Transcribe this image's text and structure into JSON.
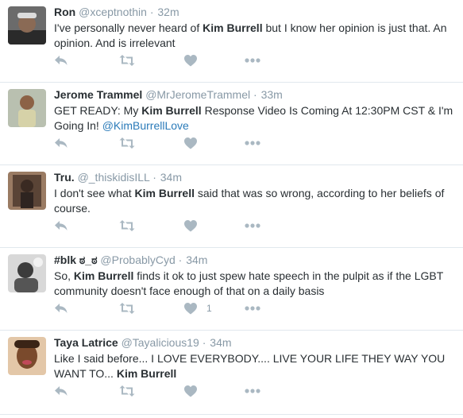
{
  "tweets": [
    {
      "name": "Ron",
      "handle": "@xceptnothin",
      "time": "32m",
      "text_parts": [
        "I've personally never heard of ",
        "Kim Burrell",
        " but I know her opinion is just that. An opinion. And is irrelevant"
      ],
      "likes": ""
    },
    {
      "name": "Jerome Trammel",
      "handle": "@MrJeromeTrammel",
      "time": "33m",
      "text_parts": [
        "GET READY: My ",
        "Kim Burrell",
        " Response Video Is Coming At 12:30PM CST & I'm Going In! ",
        "@KimBurrellLove"
      ],
      "likes": ""
    },
    {
      "name": "Tru.",
      "handle": "@_thiskidisILL",
      "time": "34m",
      "text_parts": [
        "I don't see what ",
        "Kim Burrell",
        " said that was so wrong, according to her beliefs of course."
      ],
      "likes": ""
    },
    {
      "name": "#blk ಠ_ಠ",
      "handle": "@ProbablyCyd",
      "time": "34m",
      "text_parts": [
        "So, ",
        "Kim Burrell",
        " finds it ok to just spew hate speech in the pulpit as if the LGBT community doesn't face enough of that on a daily basis"
      ],
      "likes": "1"
    },
    {
      "name": "Taya Latrice",
      "handle": "@Tayalicious19",
      "time": "34m",
      "text_parts": [
        "Like I said before... I LOVE EVERYBODY.... LIVE YOUR LIFE THEY WAY YOU WANT TO... ",
        "Kim Burrell"
      ],
      "likes": ""
    }
  ],
  "separator": "·",
  "icons": {
    "reply": "reply-icon",
    "retweet": "retweet-icon",
    "like": "heart-icon",
    "more": "more-icon"
  },
  "colors": {
    "name": "#292f33",
    "meta": "#8899a6",
    "icon": "#aab8c2",
    "link": "#2b7bb9",
    "divider": "#e1e8ed"
  }
}
